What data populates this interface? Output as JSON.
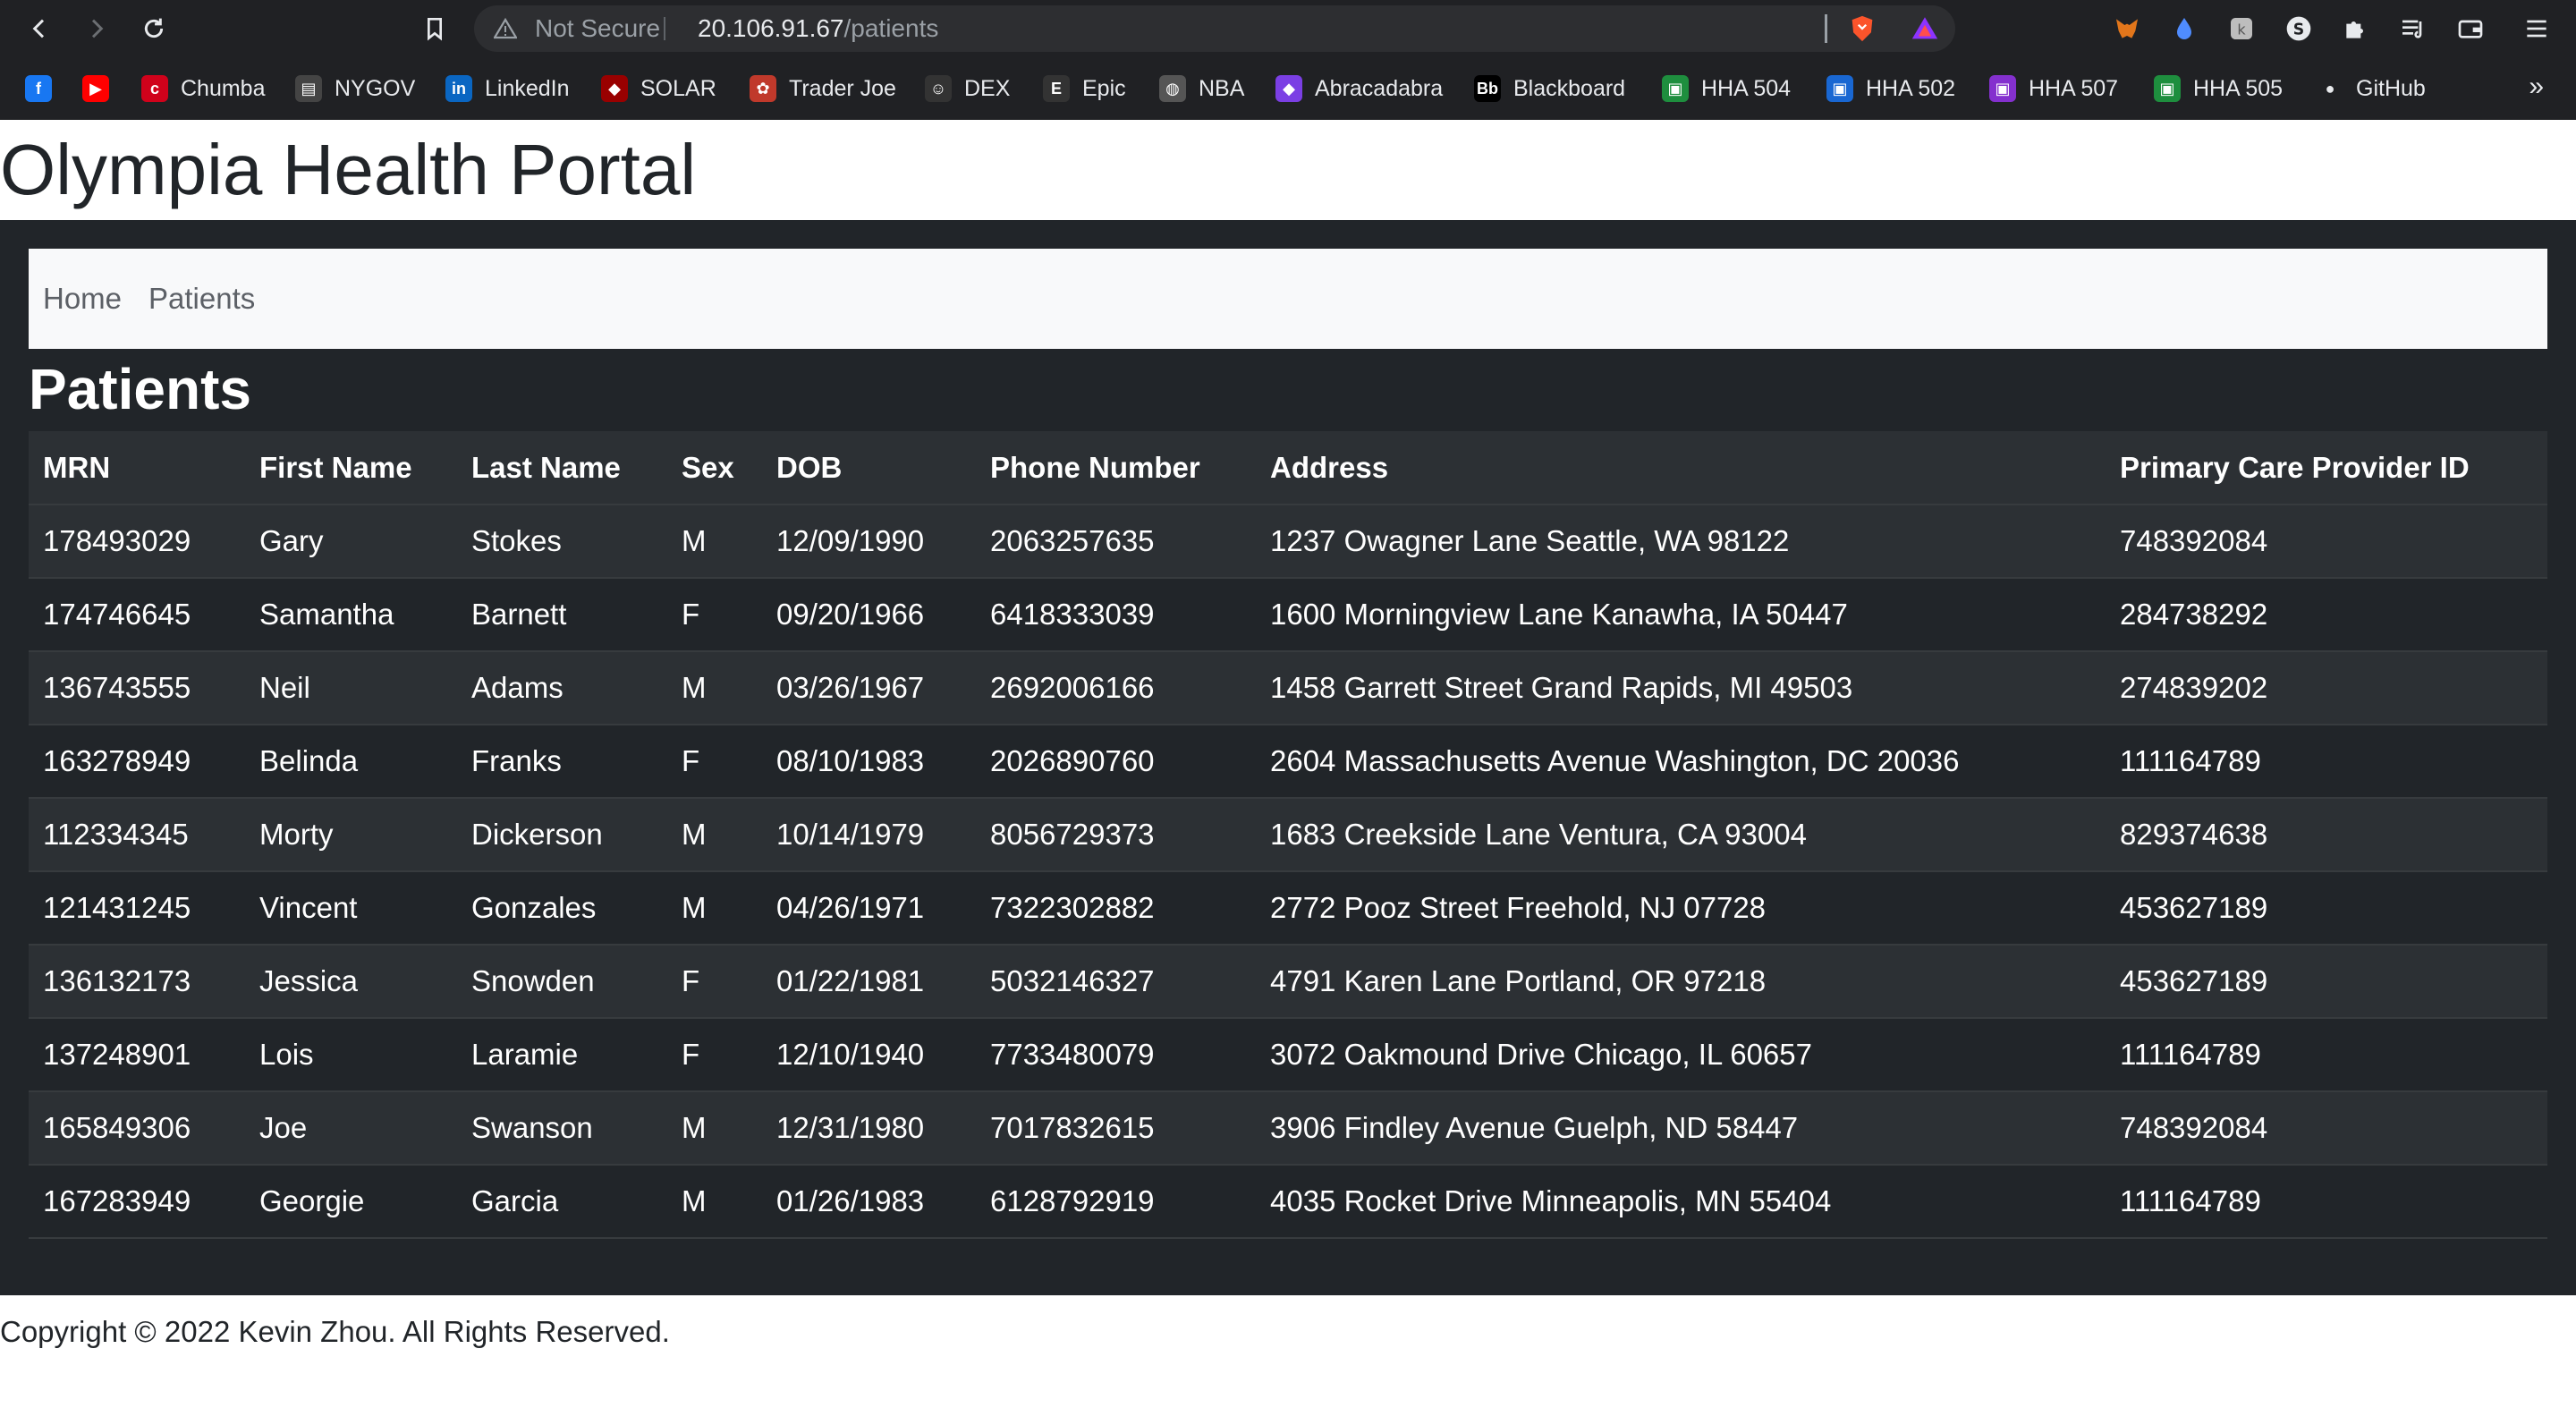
{
  "browser": {
    "security_label": "Not Secure",
    "url_host": "20.106.91.67",
    "url_path": "/patients",
    "bookmarks": [
      {
        "label": "",
        "icon": "facebook-icon",
        "color": "#1877f2",
        "glyph": "f"
      },
      {
        "label": "",
        "icon": "youtube-icon",
        "color": "#ff0000",
        "glyph": "▶"
      },
      {
        "label": "Chumba",
        "icon": "chumba-icon",
        "color": "#d0021b",
        "glyph": "c"
      },
      {
        "label": "NYGOV",
        "icon": "nygov-icon",
        "color": "#444444",
        "glyph": "▤"
      },
      {
        "label": "LinkedIn",
        "icon": "linkedin-icon",
        "color": "#0a66c2",
        "glyph": "in"
      },
      {
        "label": "SOLAR",
        "icon": "solar-icon",
        "color": "#990000",
        "glyph": "◆"
      },
      {
        "label": "Trader Joe",
        "icon": "trader-joe-icon",
        "color": "#c0392b",
        "glyph": "✿"
      },
      {
        "label": "DEX",
        "icon": "dex-icon",
        "color": "#333333",
        "glyph": "☺"
      },
      {
        "label": "Epic",
        "icon": "epic-icon",
        "color": "#333333",
        "glyph": "E"
      },
      {
        "label": "NBA",
        "icon": "nba-icon",
        "color": "#555555",
        "glyph": "◍"
      },
      {
        "label": "Abracadabra",
        "icon": "abracadabra-icon",
        "color": "#7b3fe4",
        "glyph": "◆"
      },
      {
        "label": "Blackboard",
        "icon": "blackboard-icon",
        "color": "#000000",
        "glyph": "Bb"
      },
      {
        "label": "HHA 504",
        "icon": "classroom-icon",
        "color": "#1e8e3e",
        "glyph": "▣"
      },
      {
        "label": "HHA 502",
        "icon": "classroom-icon",
        "color": "#1967d2",
        "glyph": "▣"
      },
      {
        "label": "HHA 507",
        "icon": "classroom-icon",
        "color": "#8430ce",
        "glyph": "▣"
      },
      {
        "label": "HHA 505",
        "icon": "classroom-icon",
        "color": "#1e8e3e",
        "glyph": "▣"
      },
      {
        "label": "GitHub",
        "icon": "github-icon",
        "color": "#e8eaed",
        "glyph": "●"
      }
    ],
    "bookmarks_overflow": "»"
  },
  "site": {
    "title": "Olympia Health Portal"
  },
  "nav": {
    "home": "Home",
    "patients": "Patients"
  },
  "page": {
    "heading": "Patients"
  },
  "table": {
    "columns": [
      "MRN",
      "First Name",
      "Last Name",
      "Sex",
      "DOB",
      "Phone Number",
      "Address",
      "Primary Care Provider ID"
    ],
    "rows": [
      [
        "178493029",
        "Gary",
        "Stokes",
        "M",
        "12/09/1990",
        "2063257635",
        "1237 Owagner Lane Seattle, WA 98122",
        "748392084"
      ],
      [
        "174746645",
        "Samantha",
        "Barnett",
        "F",
        "09/20/1966",
        "6418333039",
        "1600 Morningview Lane Kanawha, IA 50447",
        "284738292"
      ],
      [
        "136743555",
        "Neil",
        "Adams",
        "M",
        "03/26/1967",
        "2692006166",
        "1458 Garrett Street Grand Rapids, MI 49503",
        "274839202"
      ],
      [
        "163278949",
        "Belinda",
        "Franks",
        "F",
        "08/10/1983",
        "2026890760",
        "2604 Massachusetts Avenue Washington, DC 20036",
        "111164789"
      ],
      [
        "112334345",
        "Morty",
        "Dickerson",
        "M",
        "10/14/1979",
        "8056729373",
        "1683 Creekside Lane Ventura, CA 93004",
        "829374638"
      ],
      [
        "121431245",
        "Vincent",
        "Gonzales",
        "M",
        "04/26/1971",
        "7322302882",
        "2772 Pooz Street Freehold, NJ 07728",
        "453627189"
      ],
      [
        "136132173",
        "Jessica",
        "Snowden",
        "F",
        "01/22/1981",
        "5032146327",
        "4791 Karen Lane Portland, OR 97218",
        "453627189"
      ],
      [
        "137248901",
        "Lois",
        "Laramie",
        "F",
        "12/10/1940",
        "7733480079",
        "3072 Oakmound Drive Chicago, IL 60657",
        "111164789"
      ],
      [
        "165849306",
        "Joe",
        "Swanson",
        "M",
        "12/31/1980",
        "7017832615",
        "3906 Findley Avenue Guelph, ND 58447",
        "748392084"
      ],
      [
        "167283949",
        "Georgie",
        "Garcia",
        "M",
        "01/26/1983",
        "6128792919",
        "4035 Rocket Drive Minneapolis, MN 55404",
        "111164789"
      ]
    ]
  },
  "footer": {
    "copyright": "Copyright © 2022 Kevin Zhou. All Rights Reserved."
  }
}
